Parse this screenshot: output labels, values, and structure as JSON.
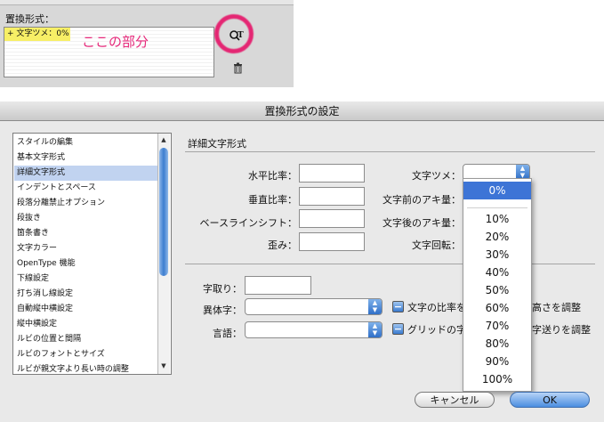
{
  "snippet": {
    "label": "置換形式：",
    "item": "+ 文字ツメ：0%",
    "note": "ここの部分",
    "style_icon": "ᴀ",
    "trash_icon": "🗑"
  },
  "dialog": {
    "title": "置換形式の設定",
    "categories": [
      "スタイルの編集",
      "基本文字形式",
      "詳細文字形式",
      "インデントとスペース",
      "段落分離禁止オプション",
      "段抜き",
      "箇条書き",
      "文字カラー",
      "OpenType 機能",
      "下線設定",
      "打ち消し線設定",
      "自動縦中横設定",
      "縦中横設定",
      "ルビの位置と間隔",
      "ルビのフォントとサイズ",
      "ルビが親文字より長い時の調整"
    ],
    "selected_category": "詳細文字形式",
    "section_title": "詳細文字形式",
    "left_fields": [
      {
        "label": "水平比率：",
        "value": ""
      },
      {
        "label": "垂直比率：",
        "value": ""
      },
      {
        "label": "ベースラインシフト：",
        "value": ""
      },
      {
        "label": "歪み：",
        "value": ""
      }
    ],
    "right_fields": [
      {
        "label": "文字ツメ：",
        "value": ""
      },
      {
        "label": "文字前のアキ量：",
        "value": ""
      },
      {
        "label": "文字後のアキ量：",
        "value": ""
      },
      {
        "label": "文字回転：",
        "value": ""
      }
    ],
    "lower": {
      "kerning_label": "字取り：",
      "kerning_value": "",
      "variant_label": "異体字：",
      "variant_value": "",
      "language_label": "言語：",
      "language_value": "",
      "check1_label_a": "文字の比率を",
      "check1_label_b": "高さを調整",
      "check2_label_a": "グリッドの字",
      "check2_label_b": "字送りを調整"
    },
    "dropdown_items": [
      "0%",
      "10%",
      "20%",
      "30%",
      "40%",
      "50%",
      "60%",
      "70%",
      "80%",
      "90%",
      "100%"
    ],
    "dropdown_selected": "0%",
    "cancel_label": "キャンセル",
    "ok_label": "OK"
  }
}
